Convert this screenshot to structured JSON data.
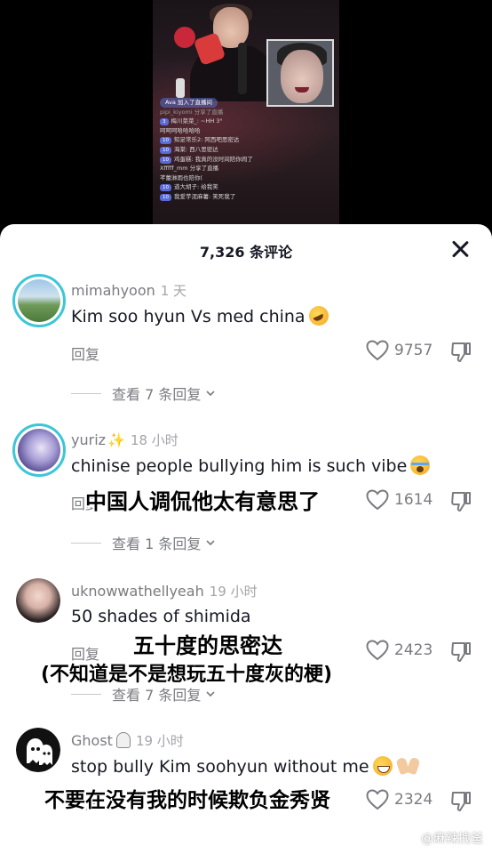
{
  "live": {
    "feed": [
      {
        "badge": "",
        "text": "Ava 加入了直播间",
        "type": "join"
      },
      {
        "badge": "",
        "text": "pipi_kiyomi 分享了直播",
        "type": "dim"
      },
      {
        "badge": "3",
        "text": "梅川菜菜_: ~HH 3°",
        "type": "msg"
      },
      {
        "badge": "",
        "text": "呵呵呵哈哈哈哈",
        "type": "plain"
      },
      {
        "badge": "10",
        "text": "知足常乐2: 阿西吧思密达",
        "type": "msg"
      },
      {
        "badge": "10",
        "text": "海棠: 西八思密达",
        "type": "msg"
      },
      {
        "badge": "10",
        "text": "鸡蛋糕: 我真的没时间陪你闹了",
        "type": "msg"
      },
      {
        "badge": "",
        "text": "Xfffff_mm 分享了直播",
        "type": "plain"
      },
      {
        "badge": "",
        "text": "芊蕾淋雨也陪你(",
        "type": "plain"
      },
      {
        "badge": "10",
        "text": "道大胡子: 给我笑",
        "type": "msg"
      },
      {
        "badge": "10",
        "text": "我爱芋泥麻薯: 笑死我了",
        "type": "msg"
      }
    ]
  },
  "sheet": {
    "title": "7,326 条评论"
  },
  "comments": [
    {
      "user": "mimahyoon",
      "time": "1 天",
      "text": "Kim soo hyun Vs med china",
      "reply_label": "回复",
      "likes": "9757",
      "view_replies": "查看 7 条回复"
    },
    {
      "user": "yuriz",
      "time": "18 小时",
      "text": "chinise people bullying him is such vibe",
      "reply_label": "回复",
      "likes": "1614",
      "view_replies": "查看 1 条回复",
      "caption": "中国人调侃他太有意思了"
    },
    {
      "user": "uknowwathellyeah",
      "time": "19 小时",
      "text": "50 shades of shimida",
      "reply_label": "回复",
      "likes": "2423",
      "view_replies": "查看 7 条回复",
      "caption_1": "五十度的思密达",
      "caption_2": "(不知道是不是想玩五十度灰的梗)"
    },
    {
      "user": "Ghost",
      "time": "19 小时",
      "text": "stop bully Kim soohyun without me",
      "reply_label": "回复",
      "likes": "2324",
      "caption": "不要在没有我的时候欺负金秀贤"
    }
  ],
  "watermark": "@麻辣拽爸",
  "colors": {
    "avatar_ring": "#3cc6d8",
    "meta_text": "#7a7b80",
    "primary_text": "#161823"
  }
}
